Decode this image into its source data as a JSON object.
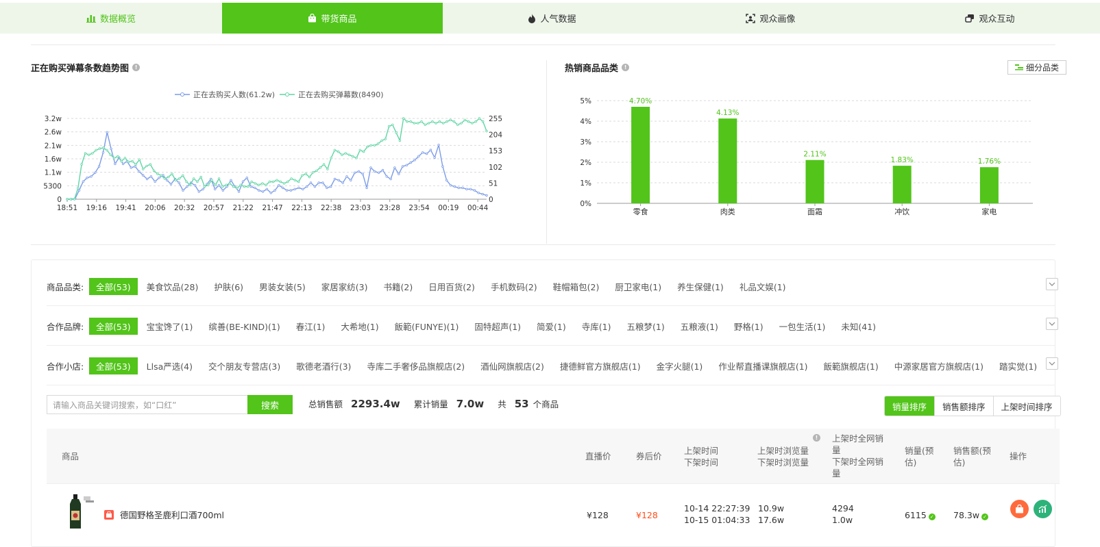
{
  "tabs": [
    {
      "label": "数据概览",
      "icon": "bar-chart-icon"
    },
    {
      "label": "带货商品",
      "icon": "shopping-bag-icon"
    },
    {
      "label": "人气数据",
      "icon": "flame-icon"
    },
    {
      "label": "观众画像",
      "icon": "portrait-scan-icon"
    },
    {
      "label": "观众互动",
      "icon": "chat-icon"
    }
  ],
  "trend": {
    "title": "正在购买弹幕条数趋势图"
  },
  "hot": {
    "title": "热销商品品类",
    "sub_button": "细分品类"
  },
  "chart_data": [
    {
      "type": "line",
      "title": "正在购买弹幕条数趋势图",
      "x": [
        "18:51",
        "19:16",
        "19:41",
        "20:06",
        "20:32",
        "20:57",
        "21:22",
        "21:47",
        "22:13",
        "22:38",
        "23:03",
        "23:28",
        "23:54",
        "00:19",
        "00:44"
      ],
      "y_left_ticks": [
        "0",
        "5300",
        "1.1w",
        "1.6w",
        "2.1w",
        "2.6w",
        "3.2w"
      ],
      "y_right_ticks": [
        "0",
        "51",
        "102",
        "153",
        "204",
        "255"
      ],
      "y_left_range": [
        0,
        32000
      ],
      "y_right_range": [
        0,
        255
      ],
      "grid": "dashed-horizontal",
      "legend_position": "top",
      "series": [
        {
          "name": "正在去购买人数(61.2w)",
          "color": "#7b9ce8",
          "axis": "left",
          "values": [
            0,
            0,
            300,
            3500,
            7000,
            8500,
            9000,
            10500,
            13000,
            18500,
            26500,
            20000,
            14000,
            16500,
            14000,
            15000,
            12500,
            13000,
            11000,
            9500,
            8000,
            9000,
            7000,
            8500,
            9500,
            7500,
            6000,
            8000,
            6500,
            3500,
            5000,
            6500,
            5500,
            3000,
            4000,
            6000,
            8000,
            4000,
            5500,
            3500,
            5000,
            7500,
            5000,
            3000,
            7000,
            8500,
            5000,
            4500,
            3500,
            3000,
            4000,
            2500,
            3500,
            5500,
            4500,
            3500,
            3500,
            4000,
            4500,
            4000,
            5000,
            6500,
            5000,
            6500,
            6500,
            4500,
            5000,
            8000,
            7500,
            6500,
            9000,
            7500,
            10500,
            11000,
            10000,
            4500,
            12500,
            11000,
            10500,
            11500,
            9000,
            8000,
            12500,
            10000,
            13000,
            13500,
            14500,
            15500,
            17000,
            18500,
            18000,
            19500,
            16500,
            21500,
            13000,
            7500,
            5500,
            5000,
            4500,
            4500,
            4000,
            4000,
            3500,
            2500,
            2000,
            1500
          ]
        },
        {
          "name": "正在去购买弹幕数(8490)",
          "color": "#5fd6a4",
          "axis": "right",
          "values": [
            0,
            0,
            0,
            35,
            110,
            145,
            140,
            145,
            155,
            160,
            162,
            155,
            140,
            130,
            135,
            120,
            130,
            118,
            120,
            110,
            125,
            95,
            105,
            110,
            90,
            80,
            75,
            65,
            70,
            80,
            60,
            65,
            75,
            55,
            45,
            65,
            55,
            70,
            40,
            45,
            60,
            45,
            65,
            40,
            45,
            50,
            40,
            35,
            45,
            40,
            40,
            55,
            50,
            45,
            50,
            45,
            55,
            55,
            60,
            55,
            50,
            55,
            65,
            60,
            55,
            75,
            80,
            70,
            85,
            90,
            100,
            110,
            95,
            130,
            155,
            150,
            140,
            145,
            140,
            135,
            130,
            155,
            150,
            165,
            170,
            170,
            175,
            185,
            190,
            230,
            235,
            210,
            185,
            255,
            245,
            245,
            240,
            240,
            245,
            235,
            240,
            245,
            240,
            245,
            240,
            245,
            250,
            245,
            235,
            240,
            250,
            245,
            240,
            245,
            255,
            245,
            215
          ]
        }
      ]
    },
    {
      "type": "bar",
      "title": "热销商品品类",
      "categories": [
        "零食",
        "肉类",
        "面霜",
        "冲饮",
        "家电"
      ],
      "values": [
        4.7,
        4.13,
        2.11,
        1.83,
        1.76
      ],
      "labels": [
        "4.70%",
        "4.13%",
        "2.11%",
        "1.83%",
        "1.76%"
      ],
      "y_ticks": [
        "0%",
        "1%",
        "2%",
        "3%",
        "4%",
        "5%"
      ],
      "ylim": [
        0,
        5
      ],
      "color": "#52c41a",
      "grid": "dashed-horizontal"
    }
  ],
  "filters": {
    "category": {
      "label": "商品品类:",
      "items": [
        "全部(53)",
        "美食饮品(28)",
        "护肤(6)",
        "男装女装(5)",
        "家居家纺(3)",
        "书籍(2)",
        "日用百货(2)",
        "手机数码(2)",
        "鞋帽箱包(2)",
        "厨卫家电(1)",
        "养生保健(1)",
        "礼品文娱(1)"
      ]
    },
    "brand": {
      "label": "合作品牌:",
      "items": [
        "全部(53)",
        "宝宝馋了(1)",
        "缤善(BE-KIND)(1)",
        "春江(1)",
        "大希地(1)",
        "飯範(FUNYE)(1)",
        "固特超声(1)",
        "简爱(1)",
        "寺库(1)",
        "五粮梦(1)",
        "五粮液(1)",
        "野格(1)",
        "一包生活(1)",
        "未知(41)"
      ]
    },
    "shop": {
      "label": "合作小店:",
      "items": [
        "全部(53)",
        "Llsa严选(4)",
        "交个朋友专营店(3)",
        "歌德老酒行(3)",
        "寺库二手奢侈品旗舰店(2)",
        "酒仙网旗舰店(2)",
        "捷德鲜官方旗舰店(1)",
        "金字火腿(1)",
        "作业帮直播课旗舰店(1)",
        "飯範旗舰店(1)",
        "中源家居官方旗舰店(1)",
        "踏实觉(1)"
      ]
    }
  },
  "search": {
    "placeholder": "请输入商品关键词搜索，如“口红”",
    "button": "搜索"
  },
  "stats": {
    "total_sales_label": "总销售额",
    "total_sales": "2293.4w",
    "total_volume_label": "累计销量",
    "total_volume": "7.0w",
    "count_prefix": "共",
    "count": "53",
    "count_suffix": "个商品"
  },
  "sort": [
    "销量排序",
    "销售额排序",
    "上架时间排序"
  ],
  "table": {
    "headers": {
      "product": "商品",
      "live_price": "直播价",
      "coupon_price": "券后价",
      "on_time": "上架时间",
      "off_time": "下架时间",
      "on_views": "上架时浏览量",
      "off_views": "下架时浏览量",
      "net_on_1": "上架时全网销",
      "net_on_2": "量",
      "net_off_1": "下架时全网销",
      "net_off_2": "量",
      "volume_1": "销量(预",
      "volume_2": "估)",
      "amount_1": "销售额(预",
      "amount_2": "估)",
      "ops": "操作"
    },
    "rows": [
      {
        "name": "德国野格圣鹿利口酒700ml",
        "live_price": "¥128",
        "coupon_price": "¥128",
        "on_time": "10-14 22:27:39",
        "off_time": "10-15 01:04:33",
        "on_views": "10.9w",
        "off_views": "17.6w",
        "net_on": "4294",
        "net_off": "1.0w",
        "volume": "6115",
        "amount": "78.3w"
      }
    ]
  }
}
